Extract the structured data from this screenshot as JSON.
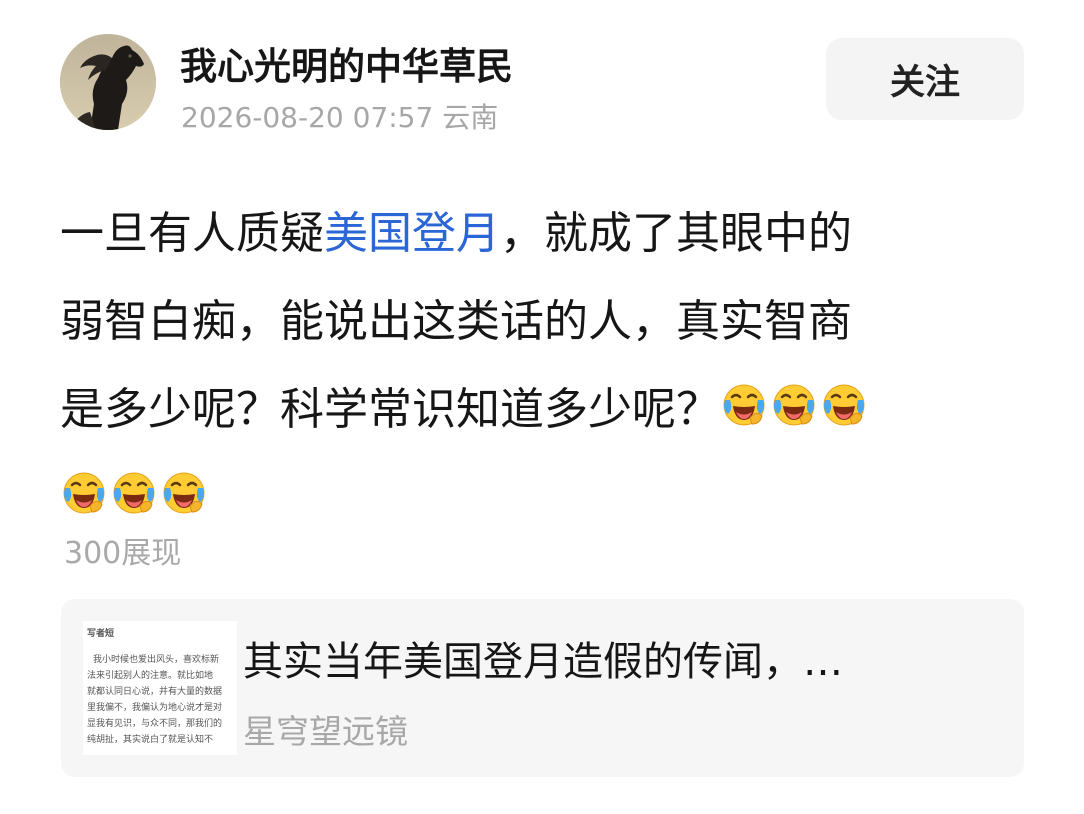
{
  "post": {
    "author": {
      "name": "我心光明的中华草民",
      "avatar": "horse-avatar"
    },
    "meta": "2026-08-20 07:57 云南",
    "follow_label": "关注",
    "content": {
      "line1_before": "一旦有人质疑",
      "topic": "美国登月",
      "line1_after": "，就成了其眼中的",
      "line2": "弱智白痴，能说出这类话的人，真实智商",
      "line3": "是多少呢？科学常识知道多少呢？",
      "emoji": "face-with-tears-of-joy",
      "emoji_count": 6
    },
    "views": "300展现"
  },
  "linked_article": {
    "title": "其实当年美国登月造假的传闻，…",
    "source": "星穹望远镜",
    "thumbnail_lines": [
      "写者短",
      "我小时候也爱出风头，喜欢标新",
      "法来引起别人的注意。就比如地",
      "就都认同日心说，并有大量的数据",
      "里我偏不，我偏认为地心说才是对",
      "显我有见识，与众不同，那我们的",
      "纯胡扯，其实说白了就是认知不"
    ]
  },
  "colors": {
    "topic_link": "#2b66d6",
    "secondary_text": "#a7a7a7",
    "card_bg": "#f6f6f6",
    "follow_bg": "#f4f4f4"
  }
}
